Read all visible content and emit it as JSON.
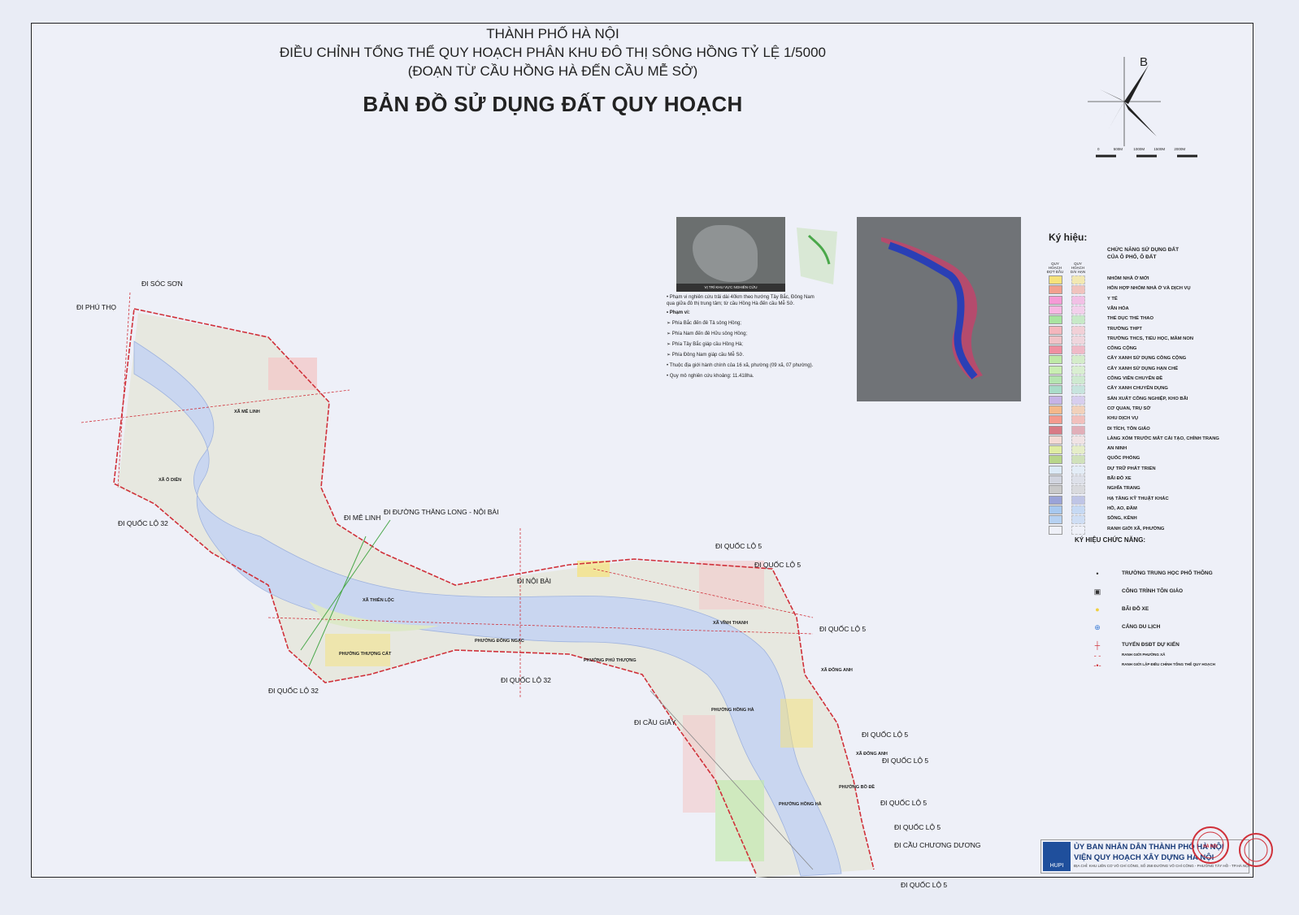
{
  "title": {
    "line1": "THÀNH PHỐ HÀ NỘI",
    "line2": "ĐIỀU CHỈNH TỔNG THỂ QUY HOẠCH PHÂN KHU ĐÔ THỊ SÔNG HỒNG TỶ LỆ 1/5000",
    "line3": "(ĐOẠN TỪ CẦU HỒNG HÀ ĐẾN CẦU MỄ SỞ)",
    "main": "BẢN ĐỒ SỬ DỤNG ĐẤT QUY HOẠCH"
  },
  "north_arrow": {
    "letter": "B",
    "scale_ticks": [
      "0",
      "500M",
      "1000M",
      "1500M",
      "2000M"
    ]
  },
  "map_labels": {
    "soc_son": "ĐI SÓC SƠN",
    "phu_tho": "ĐI PHÚ THỌ",
    "ql32_a": "ĐI QUỐC LỘ 32",
    "me_linh": "ĐI MÊ LINH",
    "thang_long": "ĐI ĐƯỜNG THĂNG LONG - NỘI BÀI",
    "noi_bai": "ĐI NỘI BÀI",
    "ql5_a": "ĐI QUỐC LỘ 5",
    "ql5_b": "ĐI QUỐC LỘ 5",
    "ql5_c": "ĐI QUỐC LỘ 5",
    "ql32_b": "ĐI QUỐC LỘ 32",
    "ql32_c": "ĐI QUỐC LỘ 32",
    "cau_giay": "ĐI CẦU GIẤY",
    "ql5_d": "ĐI QUỐC LỘ 5",
    "ql5_e": "ĐI QUỐC LỘ 5",
    "ql5_f": "ĐI QUỐC LỘ 5",
    "ql5_g": "ĐI QUỐC LỘ 5",
    "chuong_duong": "ĐI CẦU CHƯƠNG DƯƠNG",
    "ql5_h": "ĐI QUỐC LỘ 5"
  },
  "communes": {
    "me_linh": "XÃ MÊ LINH",
    "o_dien": "XÃ Ô DIÊN",
    "thien_loc": "XÃ THIÊN LỘC",
    "thuong_cat": "PHƯỜNG THƯỢNG CÁT",
    "dong_ngac": "PHƯỜNG ĐÔNG NGẠC",
    "phu_thuong": "PHƯỜNG PHÚ THƯỢNG",
    "vinh_thanh": "XÃ VĨNH THANH",
    "dong_anh": "XÃ ĐÔNG ANH",
    "hong_ha_a": "PHƯỜNG HỒNG HÀ",
    "dong_anh_b": "XÃ ĐÔNG ANH",
    "bo_de": "PHƯỜNG BỒ ĐỀ",
    "hong_ha_b": "PHƯỜNG HỒNG HÀ"
  },
  "inset": {
    "photo_caption": "VỊ TRÍ KHU VỰC NGHIÊN CỨU",
    "bullets": [
      "• Phạm vi nghiên cứu trải dài 40km theo hướng Tây Bắc, Đông Nam",
      "  qua giữa đô thị trung tâm; từ cầu Hồng Hà đến cầu Mễ Sở.",
      "• Phạm vi:",
      "  ➢ Phía Bắc đến đê Tả sông Hồng;",
      "  ➢ Phía Nam đến đê Hữu sông Hồng;",
      "  ➢ Phía Tây Bắc giáp cầu Hồng Hà;",
      "  ➢ Phía Đông Nam giáp cầu Mễ Sở.",
      "• Thuộc địa giới hành chính của 16 xã, phường (09 xã, 07 phường).",
      "• Quy mô nghiên cứu khoảng: 11.418ha."
    ]
  },
  "legend": {
    "title": "Ký hiệu:",
    "header": "CHỨC NĂNG SỬ DỤNG ĐẤT\nCỦA Ô PHỐ, Ô ĐẤT",
    "col1": "QUY HOẠCH ĐỢT ĐẦU",
    "col2": "QUY HOẠCH DÀI HẠN",
    "items": [
      {
        "label": "NHÓM NHÀ Ở MỚI",
        "color": "#f6e27a"
      },
      {
        "label": "HỖN HỢP NHÓM NHÀ Ở VÀ DỊCH VỤ",
        "color": "#f2a08f"
      },
      {
        "label": "Y TẾ",
        "color": "#f59ad6"
      },
      {
        "label": "VĂN HÓA",
        "color": "#f7b7e2"
      },
      {
        "label": "THỂ DỤC THỂ THAO",
        "color": "#a8e4a0"
      },
      {
        "label": "TRƯỜNG THPT",
        "color": "#f4b6bd"
      },
      {
        "label": "TRƯỜNG THCS, TIỂU HỌC, MẦM NON",
        "color": "#f0c2c7"
      },
      {
        "label": "CÔNG CỘNG",
        "color": "#f08fa0"
      },
      {
        "label": "CÂY XANH SỬ DỤNG CÔNG CỘNG",
        "color": "#bfe9a6"
      },
      {
        "label": "CÂY XANH SỬ DỤNG HẠN CHẾ",
        "color": "#c9eeb2"
      },
      {
        "label": "CÔNG VIÊN CHUYÊN ĐỀ",
        "color": "#b5e4b0"
      },
      {
        "label": "CÂY XANH CHUYÊN DỤNG",
        "color": "#a9dcc9"
      },
      {
        "label": "SẢN XUẤT CÔNG NGHIỆP, KHO BÃI",
        "color": "#c6b3e6"
      },
      {
        "label": "CƠ QUAN, TRỤ SỞ",
        "color": "#f4b88a"
      },
      {
        "label": "KHU DỊCH VỤ",
        "color": "#f49a8e"
      },
      {
        "label": "DI TÍCH, TÔN GIÁO",
        "color": "#d87a86"
      },
      {
        "label": "LÀNG XÓM TRƯỚC MẮT CẢI TẠO, CHỈNH TRANG",
        "color": "#f3d9d4"
      },
      {
        "label": "AN NINH",
        "color": "#dfeca2"
      },
      {
        "label": "QUỐC PHÒNG",
        "color": "#b8d68b"
      },
      {
        "label": "DỰ TRỮ PHÁT TRIỂN",
        "color": "#dbe9f6"
      },
      {
        "label": "BÃI ĐỖ XE",
        "color": "#d0d3de"
      },
      {
        "label": "NGHĨA TRANG",
        "color": "#c9c9c9"
      },
      {
        "label": "HẠ TẦNG KỸ THUẬT KHÁC",
        "color": "#9aa3d8"
      },
      {
        "label": "HỒ, AO, ĐẦM",
        "color": "#a7c8ef"
      },
      {
        "label": "SÔNG, KÊNH",
        "color": "#b6d1f2"
      },
      {
        "label": "RANH GIỚI XÃ, PHƯỜNG",
        "color": "#eef0f8"
      }
    ]
  },
  "functions": {
    "title": "KÝ HIỆU CHỨC NĂNG:",
    "items": [
      {
        "label": "TRƯỜNG TRUNG HỌC PHỔ THÔNG",
        "icon": "•"
      },
      {
        "label": "CÔNG TRÌNH TÔN GIÁO",
        "icon": "▣"
      },
      {
        "label": "BÃI ĐỖ XE",
        "icon": "●"
      },
      {
        "label": "CẢNG DU LỊCH",
        "icon": "⊕"
      },
      {
        "label": "TUYẾN ĐSĐT DỰ KIẾN",
        "icon": "┼"
      },
      {
        "label": "RANH GIỚI PHƯỜNG XÃ",
        "icon": "- -"
      },
      {
        "label": "RANH GIỚI LẬP ĐIỀU CHỈNH TỔNG THỂ QUY HOẠCH",
        "icon": "-•-"
      }
    ]
  },
  "org": {
    "line1": "ỦY BAN NHÂN DÂN THÀNH PHỐ HÀ NỘI",
    "line2": "VIỆN QUY HOẠCH XÂY DỰNG HÀ NỘI",
    "line3": "ĐỊA CHỈ: KHU LIÊN CƠ VÕ CHÍ CÔNG, SỐ 258 ĐƯỜNG VÕ CHÍ CÔNG - PHƯỜNG TÂY HỒ - TP.HÀ NỘI",
    "logo": "HUPI"
  },
  "stamp": {
    "text": "VIỆN QUY HOẠCH XÂY DỰNG HÀ NỘI"
  }
}
